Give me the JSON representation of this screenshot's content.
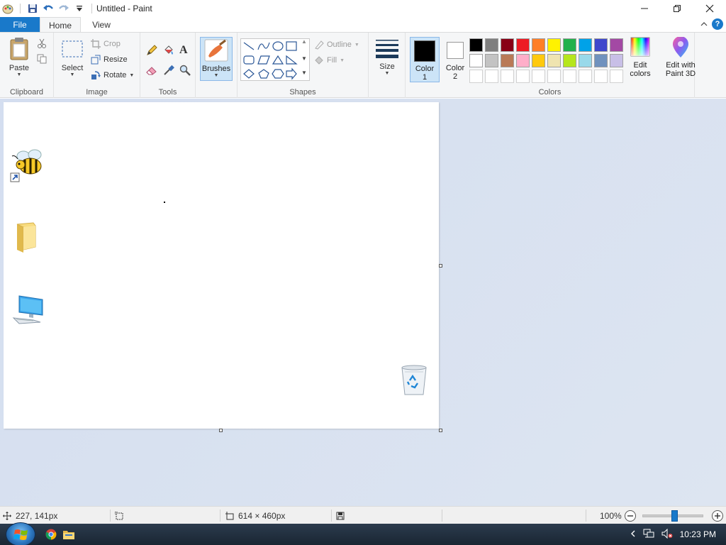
{
  "window": {
    "title": "Untitled - Paint"
  },
  "tabs": [
    {
      "label": "File"
    },
    {
      "label": "Home"
    },
    {
      "label": "View"
    }
  ],
  "ribbon": {
    "clipboard": {
      "paste_label": "Paste",
      "group_label": "Clipboard"
    },
    "image": {
      "select_label": "Select",
      "crop_label": "Crop",
      "resize_label": "Resize",
      "rotate_label": "Rotate",
      "group_label": "Image"
    },
    "tools": {
      "group_label": "Tools"
    },
    "brushes": {
      "label": "Brushes"
    },
    "shapes": {
      "outline_label": "Outline",
      "fill_label": "Fill",
      "group_label": "Shapes"
    },
    "size": {
      "label": "Size"
    },
    "colors": {
      "color1_label": "Color",
      "color1_num": "1",
      "color2_label": "Color",
      "color2_num": "2",
      "color1_value": "#000000",
      "color2_value": "#ffffff",
      "palette_row1": [
        "#000000",
        "#7f7f7f",
        "#880015",
        "#ed1c24",
        "#ff7f27",
        "#fff200",
        "#22b14c",
        "#00a2e8",
        "#3f48cc",
        "#a349a4"
      ],
      "palette_row2": [
        "#ffffff",
        "#c3c3c3",
        "#b97a57",
        "#ffaec9",
        "#ffc90e",
        "#efe4b0",
        "#b5e61d",
        "#99d9ea",
        "#7092be",
        "#c8bfe7"
      ],
      "edit_colors_line1": "Edit",
      "edit_colors_line2": "colors",
      "group_label": "Colors"
    },
    "paint3d": {
      "line1": "Edit with",
      "line2": "Paint 3D"
    }
  },
  "status": {
    "cursor_pos": "227, 141px",
    "canvas_size": "614 × 460px",
    "zoom": "100%"
  },
  "taskbar": {
    "time": "10:23 PM"
  }
}
